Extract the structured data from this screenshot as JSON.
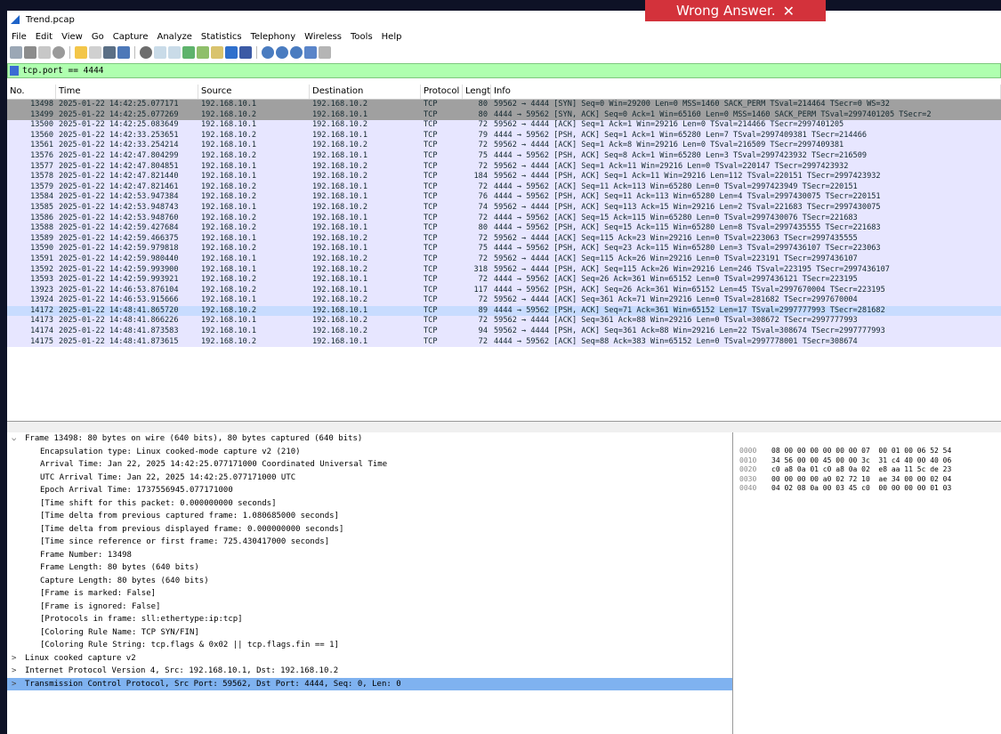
{
  "toast": {
    "text": "Wrong Answer.",
    "close": "✕"
  },
  "window": {
    "title": "Trend.pcap"
  },
  "menu": [
    "File",
    "Edit",
    "View",
    "Go",
    "Capture",
    "Analyze",
    "Statistics",
    "Telephony",
    "Wireless",
    "Tools",
    "Help"
  ],
  "filter": {
    "value": "tcp.port == 4444"
  },
  "columns": {
    "no": "No.",
    "time": "Time",
    "source": "Source",
    "destination": "Destination",
    "protocol": "Protocol",
    "length": "Lengtl",
    "info": "Info"
  },
  "packets": [
    {
      "no": "13498",
      "time": "2025-01-22 14:42:25.077171",
      "src": "192.168.10.1",
      "dst": "192.168.10.2",
      "proto": "TCP",
      "len": "80",
      "info": "59562 → 4444 [SYN] Seq=0 Win=29200 Len=0 MSS=1460 SACK_PERM TSval=214464 TSecr=0 WS=32",
      "style": "syn"
    },
    {
      "no": "13499",
      "time": "2025-01-22 14:42:25.077269",
      "src": "192.168.10.2",
      "dst": "192.168.10.1",
      "proto": "TCP",
      "len": "80",
      "info": "4444 → 59562 [SYN, ACK] Seq=0 Ack=1 Win=65160 Len=0 MSS=1460 SACK_PERM TSval=2997401205 TSecr=2",
      "style": "syn"
    },
    {
      "no": "13500",
      "time": "2025-01-22 14:42:25.083649",
      "src": "192.168.10.1",
      "dst": "192.168.10.2",
      "proto": "TCP",
      "len": "72",
      "info": "59562 → 4444 [ACK] Seq=1 Ack=1 Win=29216 Len=0 TSval=214466 TSecr=2997401205",
      "style": ""
    },
    {
      "no": "13560",
      "time": "2025-01-22 14:42:33.253651",
      "src": "192.168.10.2",
      "dst": "192.168.10.1",
      "proto": "TCP",
      "len": "79",
      "info": "4444 → 59562 [PSH, ACK] Seq=1 Ack=1 Win=65280 Len=7 TSval=2997409381 TSecr=214466",
      "style": ""
    },
    {
      "no": "13561",
      "time": "2025-01-22 14:42:33.254214",
      "src": "192.168.10.1",
      "dst": "192.168.10.2",
      "proto": "TCP",
      "len": "72",
      "info": "59562 → 4444 [ACK] Seq=1 Ack=8 Win=29216 Len=0 TSval=216509 TSecr=2997409381",
      "style": ""
    },
    {
      "no": "13576",
      "time": "2025-01-22 14:42:47.804299",
      "src": "192.168.10.2",
      "dst": "192.168.10.1",
      "proto": "TCP",
      "len": "75",
      "info": "4444 → 59562 [PSH, ACK] Seq=8 Ack=1 Win=65280 Len=3 TSval=2997423932 TSecr=216509",
      "style": ""
    },
    {
      "no": "13577",
      "time": "2025-01-22 14:42:47.804851",
      "src": "192.168.10.1",
      "dst": "192.168.10.2",
      "proto": "TCP",
      "len": "72",
      "info": "59562 → 4444 [ACK] Seq=1 Ack=11 Win=29216 Len=0 TSval=220147 TSecr=2997423932",
      "style": ""
    },
    {
      "no": "13578",
      "time": "2025-01-22 14:42:47.821440",
      "src": "192.168.10.1",
      "dst": "192.168.10.2",
      "proto": "TCP",
      "len": "184",
      "info": "59562 → 4444 [PSH, ACK] Seq=1 Ack=11 Win=29216 Len=112 TSval=220151 TSecr=2997423932",
      "style": ""
    },
    {
      "no": "13579",
      "time": "2025-01-22 14:42:47.821461",
      "src": "192.168.10.2",
      "dst": "192.168.10.1",
      "proto": "TCP",
      "len": "72",
      "info": "4444 → 59562 [ACK] Seq=11 Ack=113 Win=65280 Len=0 TSval=2997423949 TSecr=220151",
      "style": ""
    },
    {
      "no": "13584",
      "time": "2025-01-22 14:42:53.947384",
      "src": "192.168.10.2",
      "dst": "192.168.10.1",
      "proto": "TCP",
      "len": "76",
      "info": "4444 → 59562 [PSH, ACK] Seq=11 Ack=113 Win=65280 Len=4 TSval=2997430075 TSecr=220151",
      "style": ""
    },
    {
      "no": "13585",
      "time": "2025-01-22 14:42:53.948743",
      "src": "192.168.10.1",
      "dst": "192.168.10.2",
      "proto": "TCP",
      "len": "74",
      "info": "59562 → 4444 [PSH, ACK] Seq=113 Ack=15 Win=29216 Len=2 TSval=221683 TSecr=2997430075",
      "style": ""
    },
    {
      "no": "13586",
      "time": "2025-01-22 14:42:53.948760",
      "src": "192.168.10.2",
      "dst": "192.168.10.1",
      "proto": "TCP",
      "len": "72",
      "info": "4444 → 59562 [ACK] Seq=15 Ack=115 Win=65280 Len=0 TSval=2997430076 TSecr=221683",
      "style": ""
    },
    {
      "no": "13588",
      "time": "2025-01-22 14:42:59.427684",
      "src": "192.168.10.2",
      "dst": "192.168.10.1",
      "proto": "TCP",
      "len": "80",
      "info": "4444 → 59562 [PSH, ACK] Seq=15 Ack=115 Win=65280 Len=8 TSval=2997435555 TSecr=221683",
      "style": ""
    },
    {
      "no": "13589",
      "time": "2025-01-22 14:42:59.466375",
      "src": "192.168.10.1",
      "dst": "192.168.10.2",
      "proto": "TCP",
      "len": "72",
      "info": "59562 → 4444 [ACK] Seq=115 Ack=23 Win=29216 Len=0 TSval=223063 TSecr=2997435555",
      "style": ""
    },
    {
      "no": "13590",
      "time": "2025-01-22 14:42:59.979818",
      "src": "192.168.10.2",
      "dst": "192.168.10.1",
      "proto": "TCP",
      "len": "75",
      "info": "4444 → 59562 [PSH, ACK] Seq=23 Ack=115 Win=65280 Len=3 TSval=2997436107 TSecr=223063",
      "style": ""
    },
    {
      "no": "13591",
      "time": "2025-01-22 14:42:59.980440",
      "src": "192.168.10.1",
      "dst": "192.168.10.2",
      "proto": "TCP",
      "len": "72",
      "info": "59562 → 4444 [ACK] Seq=115 Ack=26 Win=29216 Len=0 TSval=223191 TSecr=2997436107",
      "style": ""
    },
    {
      "no": "13592",
      "time": "2025-01-22 14:42:59.993900",
      "src": "192.168.10.1",
      "dst": "192.168.10.2",
      "proto": "TCP",
      "len": "318",
      "info": "59562 → 4444 [PSH, ACK] Seq=115 Ack=26 Win=29216 Len=246 TSval=223195 TSecr=2997436107",
      "style": ""
    },
    {
      "no": "13593",
      "time": "2025-01-22 14:42:59.993921",
      "src": "192.168.10.2",
      "dst": "192.168.10.1",
      "proto": "TCP",
      "len": "72",
      "info": "4444 → 59562 [ACK] Seq=26 Ack=361 Win=65152 Len=0 TSval=2997436121 TSecr=223195",
      "style": ""
    },
    {
      "no": "13923",
      "time": "2025-01-22 14:46:53.876104",
      "src": "192.168.10.2",
      "dst": "192.168.10.1",
      "proto": "TCP",
      "len": "117",
      "info": "4444 → 59562 [PSH, ACK] Seq=26 Ack=361 Win=65152 Len=45 TSval=2997670004 TSecr=223195",
      "style": ""
    },
    {
      "no": "13924",
      "time": "2025-01-22 14:46:53.915666",
      "src": "192.168.10.1",
      "dst": "192.168.10.2",
      "proto": "TCP",
      "len": "72",
      "info": "59562 → 4444 [ACK] Seq=361 Ack=71 Win=29216 Len=0 TSval=281682 TSecr=2997670004",
      "style": ""
    },
    {
      "no": "14172",
      "time": "2025-01-22 14:48:41.865720",
      "src": "192.168.10.2",
      "dst": "192.168.10.1",
      "proto": "TCP",
      "len": "89",
      "info": "4444 → 59562 [PSH, ACK] Seq=71 Ack=361 Win=65152 Len=17 TSval=2997777993 TSecr=281682",
      "style": "sel"
    },
    {
      "no": "14173",
      "time": "2025-01-22 14:48:41.866226",
      "src": "192.168.10.1",
      "dst": "192.168.10.2",
      "proto": "TCP",
      "len": "72",
      "info": "59562 → 4444 [ACK] Seq=361 Ack=88 Win=29216 Len=0 TSval=308672 TSecr=2997777993",
      "style": ""
    },
    {
      "no": "14174",
      "time": "2025-01-22 14:48:41.873583",
      "src": "192.168.10.1",
      "dst": "192.168.10.2",
      "proto": "TCP",
      "len": "94",
      "info": "59562 → 4444 [PSH, ACK] Seq=361 Ack=88 Win=29216 Len=22 TSval=308674 TSecr=2997777993",
      "style": ""
    },
    {
      "no": "14175",
      "time": "2025-01-22 14:48:41.873615",
      "src": "192.168.10.2",
      "dst": "192.168.10.1",
      "proto": "TCP",
      "len": "72",
      "info": "4444 → 59562 [ACK] Seq=88 Ack=383 Win=65152 Len=0 TSval=2997778001 TSecr=308674",
      "style": ""
    }
  ],
  "details": {
    "frame_header": "Frame 13498: 80 bytes on wire (640 bits), 80 bytes captured (640 bits)",
    "frame_lines": [
      "Encapsulation type: Linux cooked-mode capture v2 (210)",
      "Arrival Time: Jan 22, 2025 14:42:25.077171000 Coordinated Universal Time",
      "UTC Arrival Time: Jan 22, 2025 14:42:25.077171000 UTC",
      "Epoch Arrival Time: 1737556945.077171000",
      "[Time shift for this packet: 0.000000000 seconds]",
      "[Time delta from previous captured frame: 1.080685000 seconds]",
      "[Time delta from previous displayed frame: 0.000000000 seconds]",
      "[Time since reference or first frame: 725.430417000 seconds]",
      "Frame Number: 13498",
      "Frame Length: 80 bytes (640 bits)",
      "Capture Length: 80 bytes (640 bits)",
      "[Frame is marked: False]",
      "[Frame is ignored: False]",
      "[Protocols in frame: sll:ethertype:ip:tcp]",
      "[Coloring Rule Name: TCP SYN/FIN]",
      "[Coloring Rule String: tcp.flags & 0x02 || tcp.flags.fin == 1]"
    ],
    "sll": "Linux cooked capture v2",
    "ip": "Internet Protocol Version 4, Src: 192.168.10.1, Dst: 192.168.10.2",
    "tcp": "Transmission Control Protocol, Src Port: 59562, Dst Port: 4444, Seq: 0, Len: 0"
  },
  "hex": [
    {
      "off": "0000",
      "bytes": "08 00 00 00 00 00 00 07  00 01 00 06 52 54"
    },
    {
      "off": "0010",
      "bytes": "34 56 00 00 45 00 00 3c  31 c4 40 00 40 06"
    },
    {
      "off": "0020",
      "bytes": "c0 a8 0a 01 c0 a8 0a 02  e8 aa 11 5c de 23"
    },
    {
      "off": "0030",
      "bytes": "00 00 00 00 a0 02 72 10  ae 34 00 00 02 04"
    },
    {
      "off": "0040",
      "bytes": "04 02 08 0a 00 03 45 c0  00 00 00 00 01 03"
    }
  ]
}
